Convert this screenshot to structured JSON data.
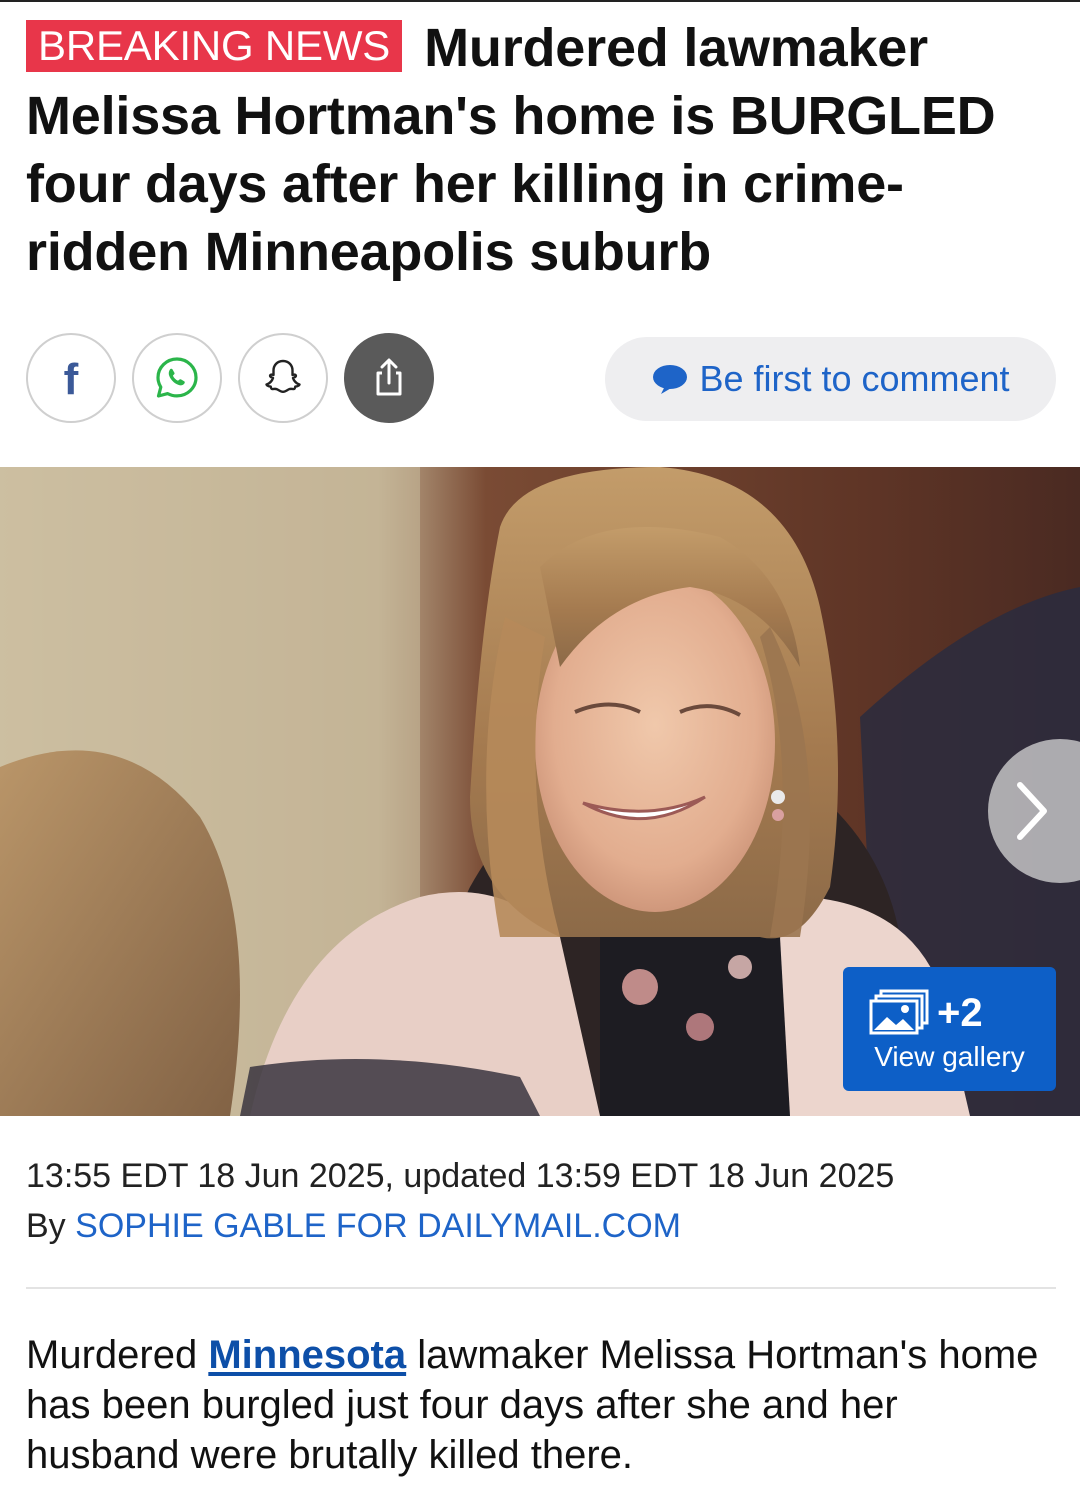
{
  "article": {
    "badge": "BREAKING NEWS",
    "headline": "Murdered lawmaker Melissa Hortman's home is BURGLED four days after her killing in crime-ridden Minneapolis suburb",
    "share": {
      "facebook_icon": "facebook-icon",
      "whatsapp_icon": "whatsapp-icon",
      "snapchat_icon": "snapchat-icon",
      "share_icon": "share-icon"
    },
    "comment_label": "Be first to comment",
    "gallery": {
      "count": "+2",
      "label": "View gallery"
    },
    "dateline": "13:55 EDT 18 Jun 2025, updated 13:59 EDT 18 Jun 2025",
    "byline_prefix": "By",
    "author": "SOPHIE GABLE FOR DAILYMAIL.COM",
    "body": {
      "p1_start": "Murdered",
      "p1_link": "Minnesota",
      "p1_end": "lawmaker Melissa Hortman's home has been burgled just four days after she and her husband were brutally killed there."
    }
  },
  "colors": {
    "badge": "#e8364a",
    "link": "#1e64c8",
    "gallery_button": "#0d5fc7",
    "comment_pill": "#eeeef0"
  }
}
